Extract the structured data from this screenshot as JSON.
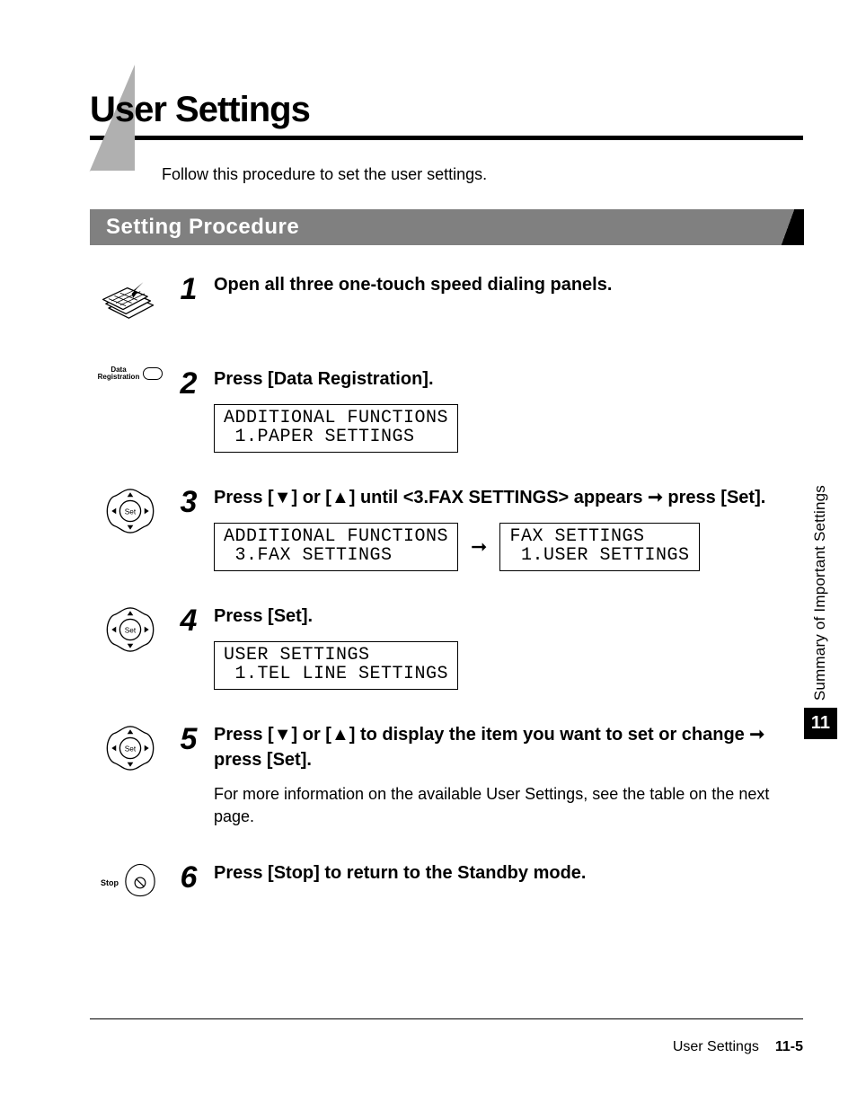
{
  "page_title": "User Settings",
  "intro_text": "Follow this procedure to set the user settings.",
  "section_heading": "Setting Procedure",
  "side_tab": {
    "label": "Summary of Important Settings",
    "chapter": "11"
  },
  "footer": {
    "section": "User Settings",
    "page": "11-5"
  },
  "icons": {
    "data_registration_label": "Data\nRegistration",
    "stop_label": "Stop",
    "set_label": "Set"
  },
  "steps": [
    {
      "num": "1",
      "title_parts": [
        "Open all three one-touch speed dialing panels."
      ],
      "icon": "panel"
    },
    {
      "num": "2",
      "title_parts": [
        "Press [Data Registration]."
      ],
      "icon": "data-registration",
      "lcd_rows": [
        [
          "ADDITIONAL FUNCTIONS\n 1.PAPER SETTINGS"
        ]
      ]
    },
    {
      "num": "3",
      "title_parts": [
        "Press [",
        "▼",
        "] or [",
        "▲",
        "] until <3.FAX SETTINGS> appears ",
        "➞",
        " press [Set]."
      ],
      "icon": "set",
      "lcd_rows": [
        [
          "ADDITIONAL FUNCTIONS\n 3.FAX SETTINGS",
          "➞",
          "FAX SETTINGS\n 1.USER SETTINGS"
        ]
      ]
    },
    {
      "num": "4",
      "title_parts": [
        "Press [Set]."
      ],
      "icon": "set",
      "lcd_rows": [
        [
          "USER SETTINGS\n 1.TEL LINE SETTINGS"
        ]
      ]
    },
    {
      "num": "5",
      "title_parts": [
        "Press [",
        "▼",
        "] or [",
        "▲",
        "] to display the item you want to set or change ",
        "➞",
        " press [Set]."
      ],
      "icon": "set",
      "desc": "For more information on the available User Settings, see the table on the next page."
    },
    {
      "num": "6",
      "title_parts": [
        "Press [Stop] to return to the Standby mode."
      ],
      "icon": "stop"
    }
  ]
}
